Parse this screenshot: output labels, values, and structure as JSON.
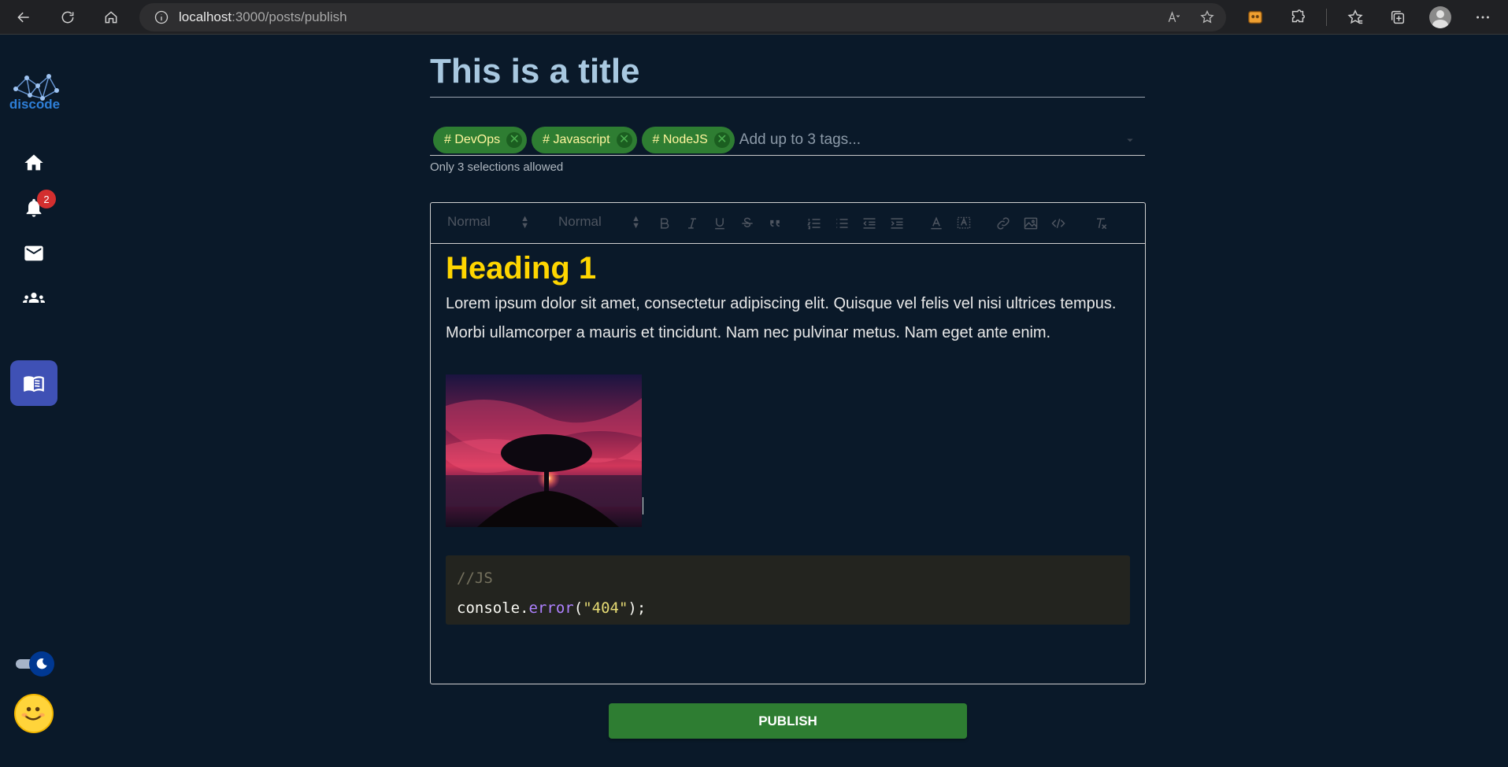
{
  "browser": {
    "url_host": "localhost",
    "url_path": ":3000/posts/publish",
    "icons": [
      "back-icon",
      "refresh-icon",
      "home-icon",
      "info-icon",
      "read-aloud-icon",
      "favorite-add-icon",
      "extension-icon",
      "puzzle-icon",
      "favorites-icon",
      "collections-icon",
      "profile-icon",
      "more-icon"
    ]
  },
  "sidebar": {
    "logo_text": "discode",
    "items": [
      {
        "icon": "home-icon"
      },
      {
        "icon": "bell-icon",
        "badge": "2"
      },
      {
        "icon": "mail-icon"
      },
      {
        "icon": "groups-icon"
      },
      {
        "icon": "book-icon",
        "active": true
      }
    ],
    "theme_toggle": "dark-mode"
  },
  "post": {
    "title": "This is a title",
    "tags": [
      "# DevOps",
      "# Javascript",
      "# NodeJS"
    ],
    "tags_placeholder": "Add up to 3 tags...",
    "tags_helper": "Only 3 selections allowed"
  },
  "editor": {
    "toolbar": {
      "header_select": "Normal",
      "size_select": "Normal",
      "buttons": [
        "bold",
        "italic",
        "underline",
        "strike",
        "blockquote",
        "ordered-list",
        "bullet-list",
        "indent-decrease",
        "indent-increase",
        "text-color",
        "background-color",
        "link",
        "image",
        "code-block",
        "clean"
      ]
    },
    "heading": "Heading 1",
    "paragraph": "Lorem ipsum dolor sit amet, consectetur adipiscing elit. Quisque vel felis vel nisi ultrices tempus. Morbi ullamcorper a mauris et tincidunt. Nam nec pulvinar metus. Nam eget ante enim.",
    "code": {
      "comment": "//JS",
      "object": "console",
      "dot": ".",
      "method": "error",
      "open": "(",
      "string": "\"404\"",
      "close": ");"
    }
  },
  "actions": {
    "publish_label": "PUBLISH"
  },
  "colors": {
    "page_bg": "#0a1929",
    "accent_green": "#2e7d32",
    "active_nav": "#3f51b5",
    "heading_yellow": "#ffd600",
    "badge_red": "#d32f2f"
  }
}
